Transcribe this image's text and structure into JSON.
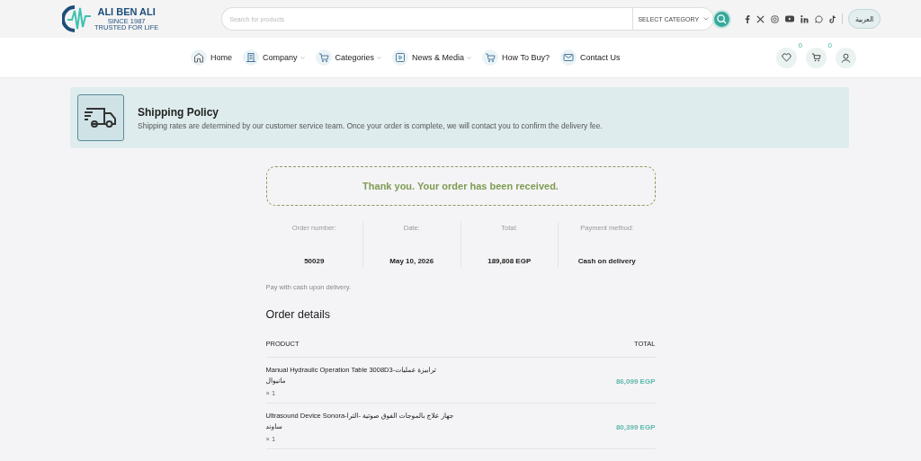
{
  "logo": {
    "name": "ALI BEN ALI",
    "since": "SINCE 1987",
    "tagline": "TRUSTED FOR LIFE"
  },
  "search": {
    "placeholder": "Search for products",
    "category": "SELECT CATEGORY"
  },
  "language": "العربية",
  "nav": [
    {
      "label": "Home",
      "dropdown": false
    },
    {
      "label": "Company",
      "dropdown": true
    },
    {
      "label": "Categories",
      "dropdown": true
    },
    {
      "label": "News & Media",
      "dropdown": true
    },
    {
      "label": "How To Buy?",
      "dropdown": false
    },
    {
      "label": "Contact Us",
      "dropdown": false
    }
  ],
  "wishlist_count": "0",
  "cart_count": "0",
  "shipping": {
    "title": "Shipping Policy",
    "text": "Shipping rates are determined by our customer service team. Once your order is complete, we will contact you to confirm the delivery fee."
  },
  "notice": "Thank you. Your order has been received.",
  "overview": [
    {
      "label": "Order number:",
      "value": "50029"
    },
    {
      "label": "Date:",
      "value": "May 10, 2026"
    },
    {
      "label": "Total:",
      "value": "189,808 EGP"
    },
    {
      "label": "Payment method:",
      "value": "Cash on delivery"
    }
  ],
  "payment_note": "Pay with cash upon delivery.",
  "details": {
    "title": "Order details",
    "columns": [
      "PRODUCT",
      "TOTAL"
    ],
    "rows": [
      {
        "name": "Manual Hydraulic Operation Table 3008D3-ترابيزة عمليات مانيوال",
        "qty": "× 1",
        "total": "86,099 EGP"
      },
      {
        "name": "Ultrasound Device Sonora-جهاز علاج بالموجات الفوق صوتية -الترا ساوند",
        "qty": "× 1",
        "total": "80,399 EGP"
      }
    ]
  }
}
